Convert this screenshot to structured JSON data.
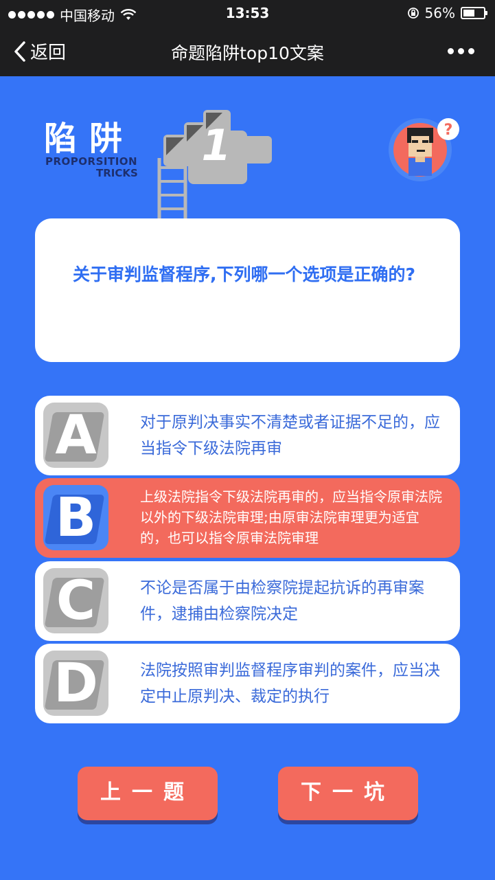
{
  "status_bar": {
    "carrier": "中国移动",
    "time": "13:53",
    "battery": "56%",
    "battery_level": 0.56
  },
  "nav": {
    "back_label": "返回",
    "title": "命题陷阱top10文案"
  },
  "header": {
    "title": "陷阱",
    "subtitle_line1": "PROPORSITION",
    "subtitle_line2": "TRICKS",
    "number": "1"
  },
  "question": {
    "text": "关于审判监督程序,下列哪一个选项是正确的?"
  },
  "options": [
    {
      "letter": "A",
      "text": "对于原判决事实不清楚或者证据不足的，应当指令下级法院再审"
    },
    {
      "letter": "B",
      "text": "上级法院指令下级法院再审的，应当指令原审法院以外的下级法院审理;由原审法院审理更为适宜的，也可以指令原审法院审理"
    },
    {
      "letter": "C",
      "text": "不论是否属于由检察院提起抗诉的再审案件，逮捕由检察院决定"
    },
    {
      "letter": "D",
      "text": "法院按照审判监督程序审判的案件，应当决定中止原判决、裁定的执行"
    }
  ],
  "buttons": {
    "prev": "上一题",
    "next": "下一坑"
  },
  "colors": {
    "background": "#3574f7",
    "accent": "#f36a5d",
    "bar": "#1e1e1f",
    "text_blue": "#2f6ef2"
  }
}
